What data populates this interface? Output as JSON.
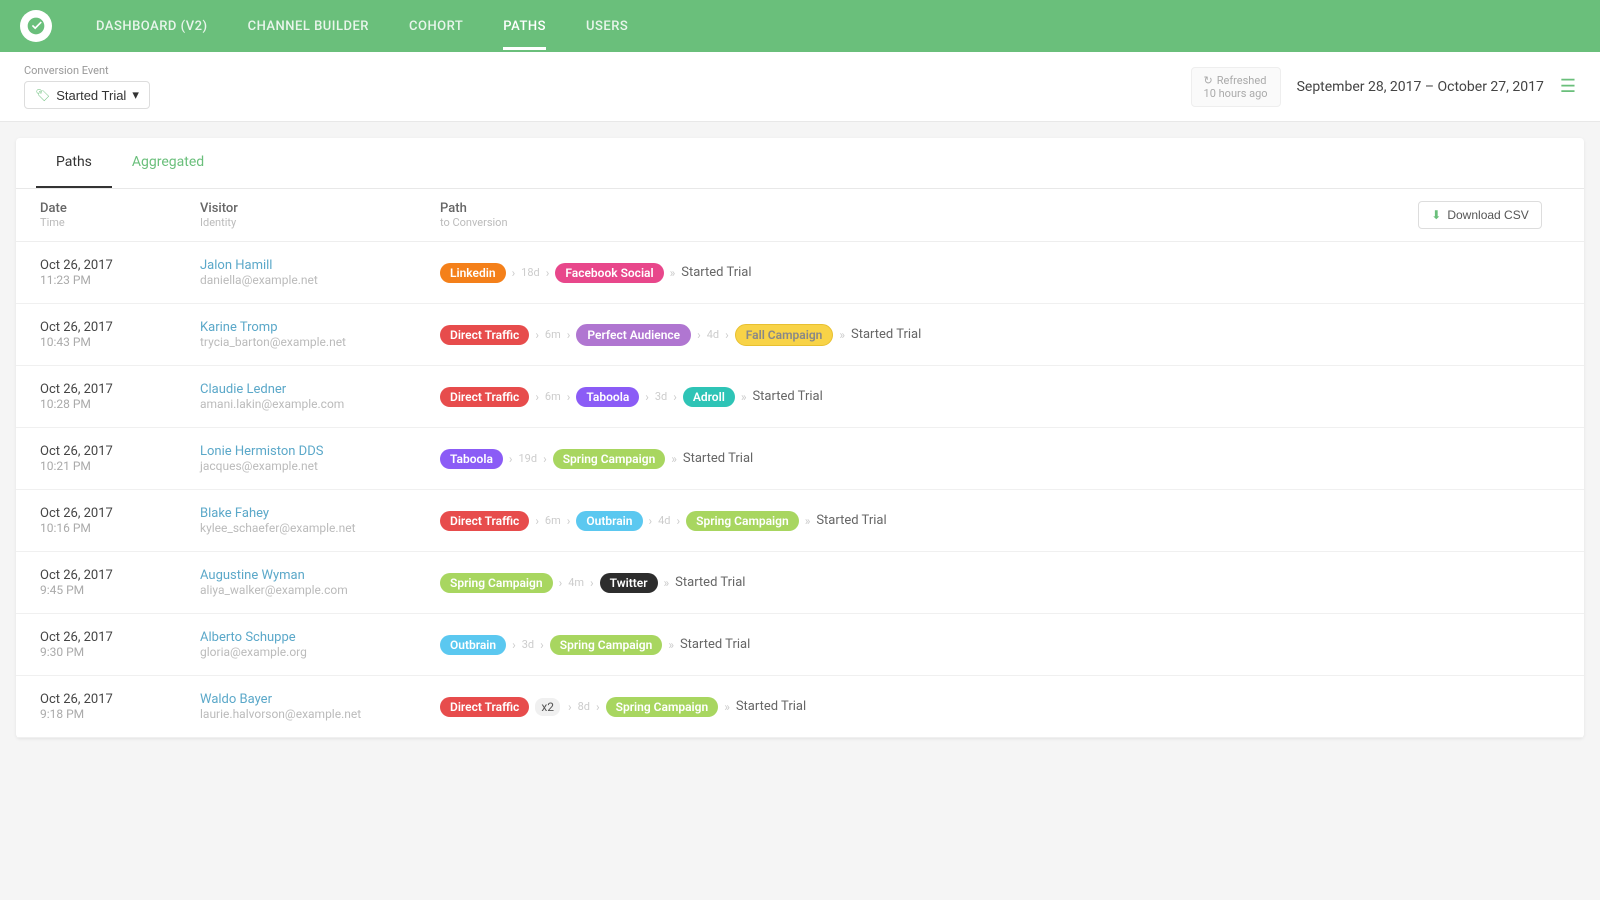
{
  "nav": {
    "logo_alt": "logo",
    "items": [
      {
        "label": "DASHBOARD (V2)",
        "active": false
      },
      {
        "label": "CHANNEL BUILDER",
        "active": false
      },
      {
        "label": "COHORT",
        "active": false
      },
      {
        "label": "PATHS",
        "active": true
      },
      {
        "label": "USERS",
        "active": false
      }
    ]
  },
  "toolbar": {
    "conversion_label": "Conversion Event",
    "conversion_btn": "Started Trial",
    "refresh_label": "Refreshed",
    "refresh_time": "10 hours ago",
    "date_range": "September 28, 2017  –  October 27, 2017"
  },
  "tabs": [
    {
      "label": "Paths",
      "active": true
    },
    {
      "label": "Aggregated",
      "active": false
    }
  ],
  "table": {
    "columns": [
      {
        "title": "Date",
        "sub": "Time"
      },
      {
        "title": "Visitor",
        "sub": "Identity"
      },
      {
        "title": "Path",
        "sub": "to Conversion"
      }
    ],
    "download_btn": "Download CSV",
    "rows": [
      {
        "date": "Oct 26, 2017",
        "time": "11:23 PM",
        "name": "Jalon Hamill",
        "email": "daniella@example.net",
        "path_parts": [
          {
            "type": "tag",
            "style": "linkedin",
            "text": "Linkedin"
          },
          {
            "type": "sep",
            "text": "›"
          },
          {
            "type": "time",
            "text": "18d"
          },
          {
            "type": "sep",
            "text": "›"
          },
          {
            "type": "tag",
            "style": "facebook",
            "text": "Facebook Social"
          },
          {
            "type": "sep",
            "text": "»"
          },
          {
            "type": "end",
            "text": "Started Trial"
          }
        ]
      },
      {
        "date": "Oct 26, 2017",
        "time": "10:43 PM",
        "name": "Karine Tromp",
        "email": "trycia_barton@example.net",
        "path_parts": [
          {
            "type": "tag",
            "style": "direct",
            "text": "Direct Traffic"
          },
          {
            "type": "sep",
            "text": "›"
          },
          {
            "type": "time",
            "text": "6m"
          },
          {
            "type": "sep",
            "text": "›"
          },
          {
            "type": "tag",
            "style": "perfect",
            "text": "Perfect Audience"
          },
          {
            "type": "sep",
            "text": "›"
          },
          {
            "type": "time",
            "text": "4d"
          },
          {
            "type": "sep",
            "text": "›"
          },
          {
            "type": "tag",
            "style": "fall",
            "text": "Fall Campaign"
          },
          {
            "type": "sep",
            "text": "»"
          },
          {
            "type": "end",
            "text": "Started Trial"
          }
        ]
      },
      {
        "date": "Oct 26, 2017",
        "time": "10:28 PM",
        "name": "Claudie Ledner",
        "email": "amani.lakin@example.com",
        "path_parts": [
          {
            "type": "tag",
            "style": "direct",
            "text": "Direct Traffic"
          },
          {
            "type": "sep",
            "text": "›"
          },
          {
            "type": "time",
            "text": "6m"
          },
          {
            "type": "sep",
            "text": "›"
          },
          {
            "type": "tag",
            "style": "taboola",
            "text": "Taboola"
          },
          {
            "type": "sep",
            "text": "›"
          },
          {
            "type": "time",
            "text": "3d"
          },
          {
            "type": "sep",
            "text": "›"
          },
          {
            "type": "tag",
            "style": "adroll",
            "text": "Adroll"
          },
          {
            "type": "sep",
            "text": "»"
          },
          {
            "type": "end",
            "text": "Started Trial"
          }
        ]
      },
      {
        "date": "Oct 26, 2017",
        "time": "10:21 PM",
        "name": "Lonie Hermiston DDS",
        "email": "jacques@example.net",
        "path_parts": [
          {
            "type": "tag",
            "style": "taboola",
            "text": "Taboola"
          },
          {
            "type": "sep",
            "text": "›"
          },
          {
            "type": "time",
            "text": "19d"
          },
          {
            "type": "sep",
            "text": "›"
          },
          {
            "type": "tag",
            "style": "spring",
            "text": "Spring Campaign"
          },
          {
            "type": "sep",
            "text": "»"
          },
          {
            "type": "end",
            "text": "Started Trial"
          }
        ]
      },
      {
        "date": "Oct 26, 2017",
        "time": "10:16 PM",
        "name": "Blake Fahey",
        "email": "kylee_schaefer@example.net",
        "path_parts": [
          {
            "type": "tag",
            "style": "direct",
            "text": "Direct Traffic"
          },
          {
            "type": "sep",
            "text": "›"
          },
          {
            "type": "time",
            "text": "6m"
          },
          {
            "type": "sep",
            "text": "›"
          },
          {
            "type": "tag",
            "style": "outbrain",
            "text": "Outbrain"
          },
          {
            "type": "sep",
            "text": "›"
          },
          {
            "type": "time",
            "text": "4d"
          },
          {
            "type": "sep",
            "text": "›"
          },
          {
            "type": "tag",
            "style": "spring",
            "text": "Spring Campaign"
          },
          {
            "type": "sep",
            "text": "»"
          },
          {
            "type": "end",
            "text": "Started Trial"
          }
        ]
      },
      {
        "date": "Oct 26, 2017",
        "time": "9:45 PM",
        "name": "Augustine Wyman",
        "email": "aliya_walker@example.com",
        "path_parts": [
          {
            "type": "tag",
            "style": "spring",
            "text": "Spring Campaign"
          },
          {
            "type": "sep",
            "text": "›"
          },
          {
            "type": "time",
            "text": "4m"
          },
          {
            "type": "sep",
            "text": "›"
          },
          {
            "type": "tag",
            "style": "twitter",
            "text": "Twitter"
          },
          {
            "type": "sep",
            "text": "»"
          },
          {
            "type": "end",
            "text": "Started Trial"
          }
        ]
      },
      {
        "date": "Oct 26, 2017",
        "time": "9:30 PM",
        "name": "Alberto Schuppe",
        "email": "gloria@example.org",
        "path_parts": [
          {
            "type": "tag",
            "style": "outbrain",
            "text": "Outbrain"
          },
          {
            "type": "sep",
            "text": "›"
          },
          {
            "type": "time",
            "text": "3d"
          },
          {
            "type": "sep",
            "text": "›"
          },
          {
            "type": "tag",
            "style": "spring",
            "text": "Spring Campaign"
          },
          {
            "type": "sep",
            "text": "»"
          },
          {
            "type": "end",
            "text": "Started Trial"
          }
        ]
      },
      {
        "date": "Oct 26, 2017",
        "time": "9:18 PM",
        "name": "Waldo Bayer",
        "email": "laurie.halvorson@example.net",
        "path_parts": [
          {
            "type": "tag",
            "style": "direct",
            "text": "Direct Traffic"
          },
          {
            "type": "multiplier",
            "text": "x2"
          },
          {
            "type": "sep",
            "text": "›"
          },
          {
            "type": "time",
            "text": "8d"
          },
          {
            "type": "sep",
            "text": "›"
          },
          {
            "type": "tag",
            "style": "spring",
            "text": "Spring Campaign"
          },
          {
            "type": "sep",
            "text": "»"
          },
          {
            "type": "end",
            "text": "Started Trial"
          }
        ]
      }
    ]
  }
}
